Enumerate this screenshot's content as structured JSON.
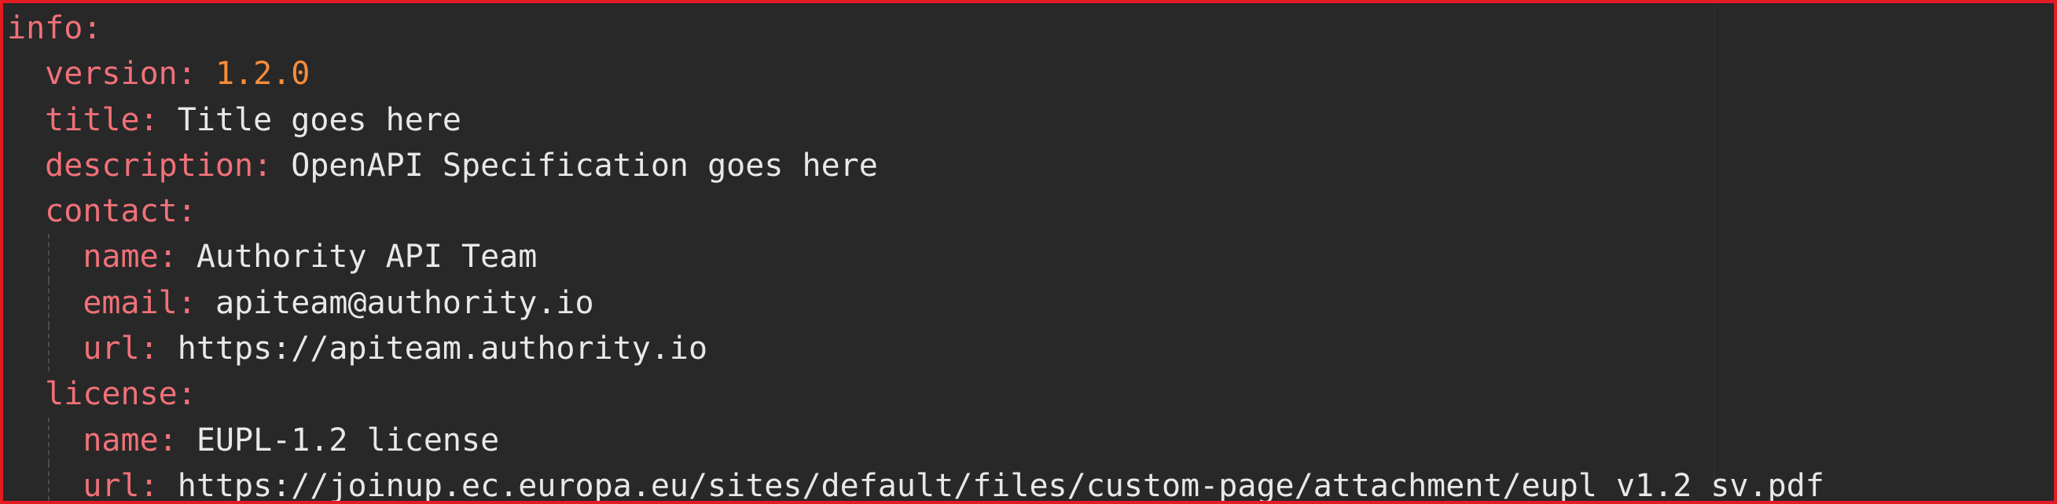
{
  "colors": {
    "background": "#282828",
    "border": "#e31b23",
    "key": "#f07178",
    "string": "#e8e8e8",
    "number": "#f78c3a"
  },
  "lines": [
    {
      "indent": 0,
      "key": "info",
      "value": "",
      "value_type": "none"
    },
    {
      "indent": 1,
      "key": "version",
      "value": "1.2.0",
      "value_type": "number"
    },
    {
      "indent": 1,
      "key": "title",
      "value": "Title goes here",
      "value_type": "string"
    },
    {
      "indent": 1,
      "key": "description",
      "value": "OpenAPI Specification goes here",
      "value_type": "string"
    },
    {
      "indent": 1,
      "key": "contact",
      "value": "",
      "value_type": "none"
    },
    {
      "indent": 2,
      "key": "name",
      "value": "Authority API Team",
      "value_type": "string"
    },
    {
      "indent": 2,
      "key": "email",
      "value": "apiteam@authority.io",
      "value_type": "string"
    },
    {
      "indent": 2,
      "key": "url",
      "value": "https://apiteam.authority.io",
      "value_type": "string"
    },
    {
      "indent": 1,
      "key": "license",
      "value": "",
      "value_type": "none"
    },
    {
      "indent": 2,
      "key": "name",
      "value": "EUPL-1.2 license",
      "value_type": "string"
    },
    {
      "indent": 2,
      "key": "url",
      "value": "https://joinup.ec.europa.eu/sites/default/files/custom-page/attachment/eupl_v1.2_sv.pdf",
      "value_type": "string"
    }
  ]
}
